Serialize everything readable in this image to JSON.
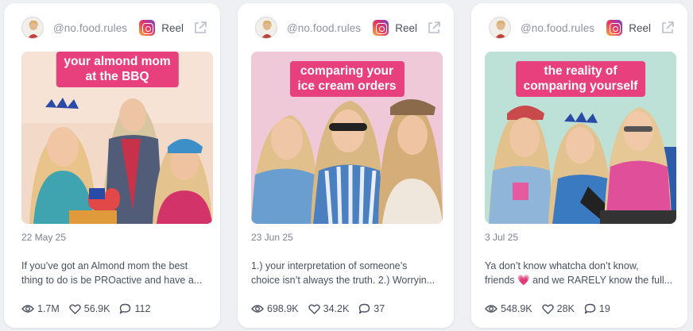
{
  "cards": [
    {
      "handle": "@no.food.rules",
      "platform_icon": "instagram-icon",
      "type": "Reel",
      "overlay_lines": [
        "your almond mom",
        "at the BBQ"
      ],
      "date": "22 May 25",
      "desc_line1": "If you’ve got an Almond mom the best",
      "desc_line2": "thing to do is be PROactive and have a...",
      "views": "1.7M",
      "likes": "56.9K",
      "comments": "112",
      "bg_color": "#f2d6c4"
    },
    {
      "handle": "@no.food.rules",
      "platform_icon": "instagram-icon",
      "type": "Reel",
      "overlay_lines": [
        "comparing your",
        "ice cream orders"
      ],
      "date": "23 Jun 25",
      "desc_line1": "1.) your interpretation of someone’s",
      "desc_line2": "choice isn’t always the truth. 2.) Worryin...",
      "views": "698.9K",
      "likes": "34.2K",
      "comments": "37",
      "bg_color": "#f1c7d8"
    },
    {
      "handle": "@no.food.rules",
      "platform_icon": "instagram-icon",
      "type": "Reel",
      "overlay_lines": [
        "the reality of",
        "comparing yourself"
      ],
      "date": "3 Jul 25",
      "desc_line1": "Ya don’t know whatcha don’t know,",
      "desc_line2_pre": "friends",
      "desc_line2_emoji": "💗",
      "desc_line2_post": "and we RARELY know the full...",
      "views": "548.9K",
      "likes": "28K",
      "comments": "19",
      "bg_color": "#bfe0d8"
    }
  ],
  "colors": {
    "accent_pink": "#e8407c",
    "page_bg": "#eef0f4",
    "card_bg": "#ffffff"
  }
}
